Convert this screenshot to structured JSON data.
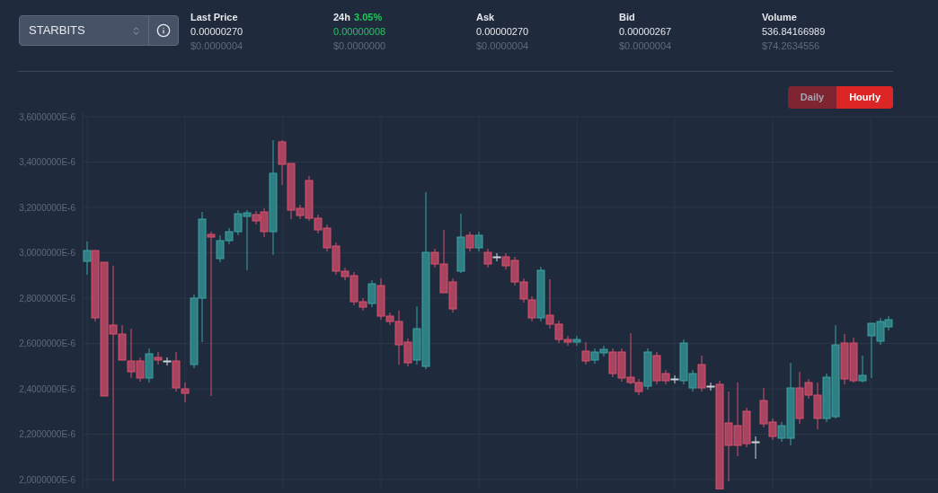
{
  "market": {
    "pair": "STARBITS"
  },
  "stats": [
    {
      "kind": "price",
      "label": "Last Price",
      "value": "0.00000270",
      "usd": "$0.0000004"
    },
    {
      "kind": "change",
      "label": "24h",
      "change": "3.05%",
      "value": "0.00000008",
      "usd": "$0.0000000"
    },
    {
      "kind": "price",
      "label": "Ask",
      "value": "0.00000270",
      "usd": "$0.0000004"
    },
    {
      "kind": "price",
      "label": "Bid",
      "value": "0.00000267",
      "usd": "$0.0000004"
    },
    {
      "kind": "price",
      "label": "Volume",
      "value": "536.84166989",
      "usd": "$74.2634556"
    }
  ],
  "interval_tabs": [
    {
      "label": "Daily",
      "selected": false
    },
    {
      "label": "Hourly",
      "selected": true
    }
  ],
  "chart": {
    "y_labels": [
      "3,6000000E-6",
      "3,4000000E-6",
      "3,2000000E-6",
      "3,0000000E-6",
      "2,8000000E-6",
      "2,6000000E-6",
      "2,4000000E-6",
      "2,2000000E-6",
      "2,0000000E-6"
    ]
  }
}
